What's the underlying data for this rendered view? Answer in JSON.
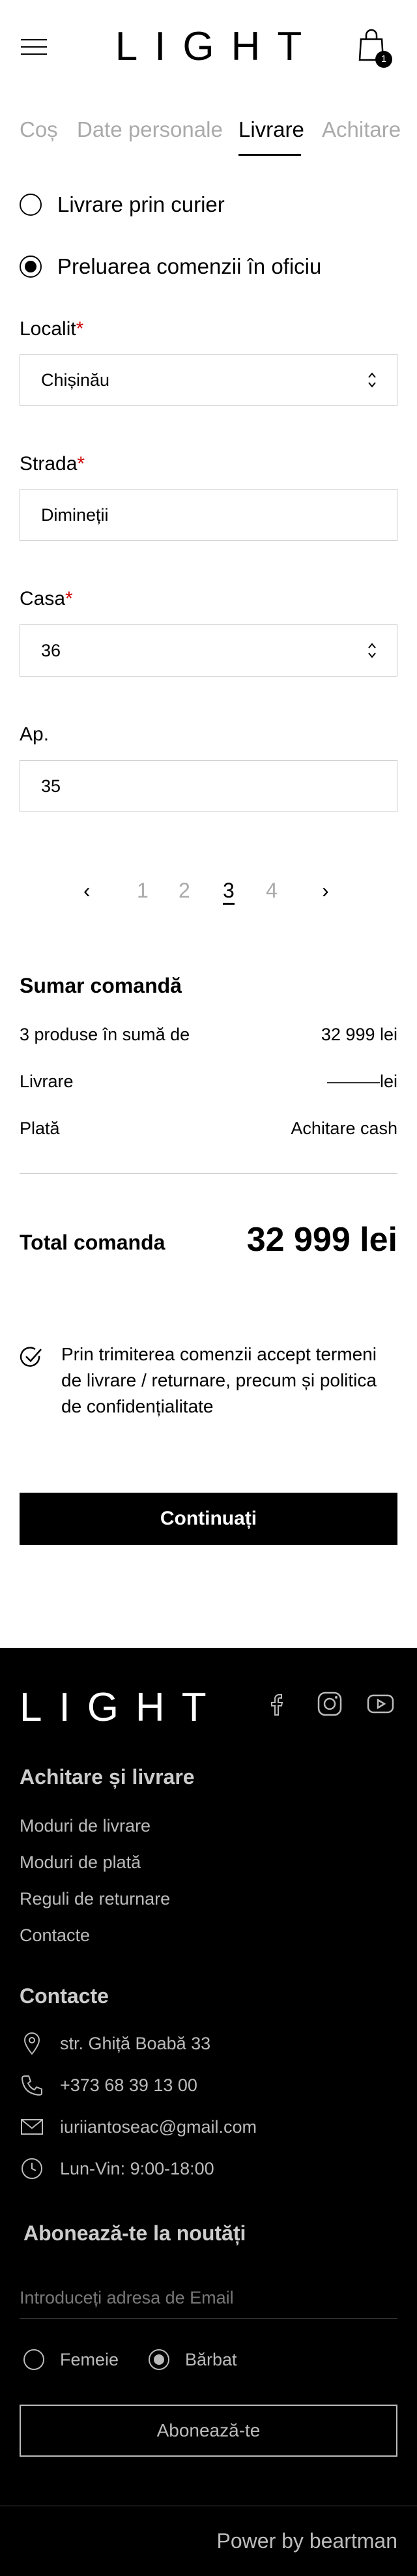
{
  "header": {
    "logo": "LIGHT",
    "cart_count": "1"
  },
  "tabs": [
    "Coș",
    "Date personale",
    "Livrare",
    "Achitare"
  ],
  "delivery": {
    "option_courier": "Livrare prin curier",
    "option_pickup": "Preluarea comenzii în oficiu",
    "selected": "Preluarea comenzii în oficiu"
  },
  "form": {
    "locality_label": "Localit",
    "locality_value": "Chișinău",
    "street_label": "Strada",
    "street_value": "Dimineții",
    "house_label": "Casa",
    "house_value": "36",
    "apartment_label": "Ap.",
    "apartment_value": "35",
    "required_mark": "*"
  },
  "pagination": {
    "prev": "‹",
    "pages": [
      "1",
      "2",
      "3",
      "4"
    ],
    "current": "3",
    "next": "›"
  },
  "summary": {
    "title": "Sumar comandă",
    "products_label": "3 produse în sumă de",
    "products_value": "32 999 lei",
    "delivery_label": "Livrare",
    "delivery_value": "———lei",
    "payment_label": "Plată",
    "payment_value": "Achitare cash",
    "total_label": "Total comanda",
    "total_value": "32 999 lei"
  },
  "consent": "Prin trimiterea comenzii accept termeni de livrare / returnare, precum și politica de confidențialitate",
  "continue_label": "Continuați",
  "footer": {
    "logo": "LIGHT",
    "payment_heading": "Achitare și livrare",
    "links": [
      "Moduri de livrare",
      "Moduri de plată",
      "Reguli de returnare",
      "Contacte"
    ],
    "contacts_heading": "Contacte",
    "address": "str. Ghiță Boabă 33",
    "phone": "+373 68 39 13 00",
    "email": "iuriiantoseac@gmail.com",
    "hours": "Lun-Vin: 9:00-18:00",
    "newsletter_heading": "Abonează-te la noutăți",
    "email_placeholder": "Introduceți adresa de Email",
    "gender_female": "Femeie",
    "gender_male": "Bărbat",
    "subscribe_label": "Abonează-te",
    "power": "Power by beartman"
  }
}
